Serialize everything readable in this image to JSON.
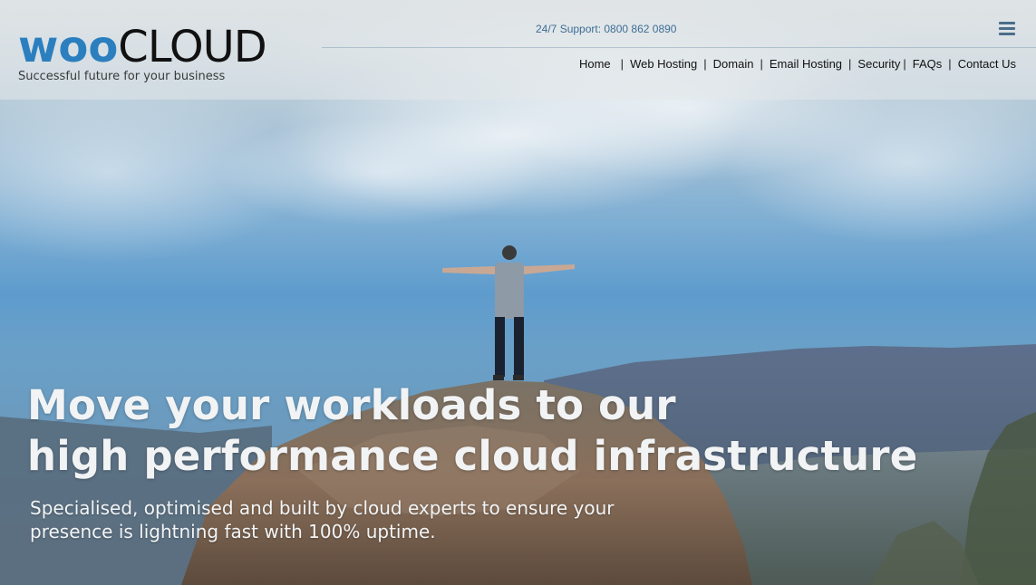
{
  "brand": {
    "logo_part1": "woo",
    "logo_part2": "CLOUD",
    "tagline": "Successful future for your business"
  },
  "header": {
    "support": "24/7 Support: 0800 862 0890",
    "menu_icon": "hamburger-menu-icon"
  },
  "nav": {
    "items": [
      {
        "label": "Home"
      },
      {
        "label": "Web Hosting"
      },
      {
        "label": "Domain"
      },
      {
        "label": "Email Hosting"
      },
      {
        "label": "Security"
      },
      {
        "label": "FAQs"
      },
      {
        "label": "Contact Us"
      }
    ],
    "separator": "|"
  },
  "hero": {
    "headline_line1": "Move your workloads to our",
    "headline_line2": "high performance cloud infrastructure",
    "subline_line1": "Specialised, optimised and built by cloud experts to ensure your",
    "subline_line2": "presence is lightning fast with 100% uptime."
  },
  "colors": {
    "brand_blue": "#2b7fbf",
    "logo_dark": "#111111",
    "support_text": "#3d6e95"
  }
}
